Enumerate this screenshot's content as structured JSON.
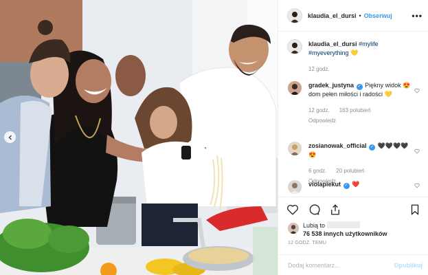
{
  "post": {
    "username": "klaudia_el_dursi",
    "separator": "•",
    "follow_label": "Obserwuj",
    "more_label": "•••",
    "comments": [
      {
        "username": "klaudia_el_dursi",
        "hashtag_1": "#mylife",
        "hashtag_2": "#myeverything",
        "emoji": "💛",
        "age": "12 godz."
      },
      {
        "username": "gradek_justyna",
        "text": "Piękny widok 😍 dom pełen miłości i radości 💛",
        "age": "12 godz.",
        "likes": "163 polubień",
        "reply": "Odpowiedz"
      },
      {
        "username": "zosianowak_official",
        "text": "🖤🖤🖤🖤😍",
        "age": "6 godz.",
        "likes": "20 polubień",
        "reply": "Odpowiedz"
      },
      {
        "username": "violapiekut",
        "text": "❤️"
      }
    ],
    "likes_prefix": "Lubią to",
    "likes_count": "76 538 innych użytkowników",
    "timestamp": "12 GODZ. TEMU",
    "add_comment_placeholder": "Dodaj komentarz...",
    "publish_label": "Opublikuj"
  },
  "colors": {
    "link_blue": "#3897f0",
    "hashtag": "#003569",
    "muted": "#8e8e8e",
    "heart_red": "#ed4956"
  }
}
